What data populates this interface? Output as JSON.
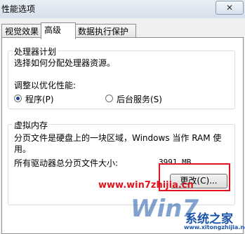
{
  "window": {
    "title": "性能选项",
    "close_label": "✕"
  },
  "tabs": [
    {
      "label": "视觉效果",
      "active": false
    },
    {
      "label": "高级",
      "active": true
    },
    {
      "label": "数据执行保护",
      "active": false
    }
  ],
  "processor_group": {
    "legend": "处理器计划",
    "description": "选择如何分配处理器资源。",
    "adjust_label": "调整以优化性能:",
    "options": [
      {
        "label": "程序(P)",
        "checked": true
      },
      {
        "label": "后台服务(S)",
        "checked": false
      }
    ]
  },
  "virtual_memory_group": {
    "legend": "虚拟内存",
    "description_line1": "分页文件是硬盘上的一块区域，Windows 当作 RAM 使",
    "description_line2": "用。",
    "total_label": "所有驱动器总分页文件大小:",
    "total_value": "3991 MB",
    "change_button": "更改(C)..."
  },
  "watermark": {
    "url_text": "www.win7zhijia.cn",
    "logo_text": "Win7",
    "site_name": "系统之家",
    "site_url": "www.xitongzhijia.net"
  },
  "colors": {
    "highlight": "#e0141e",
    "watermark_red": "#e0141e",
    "watermark_blue": "#1c55a8"
  }
}
